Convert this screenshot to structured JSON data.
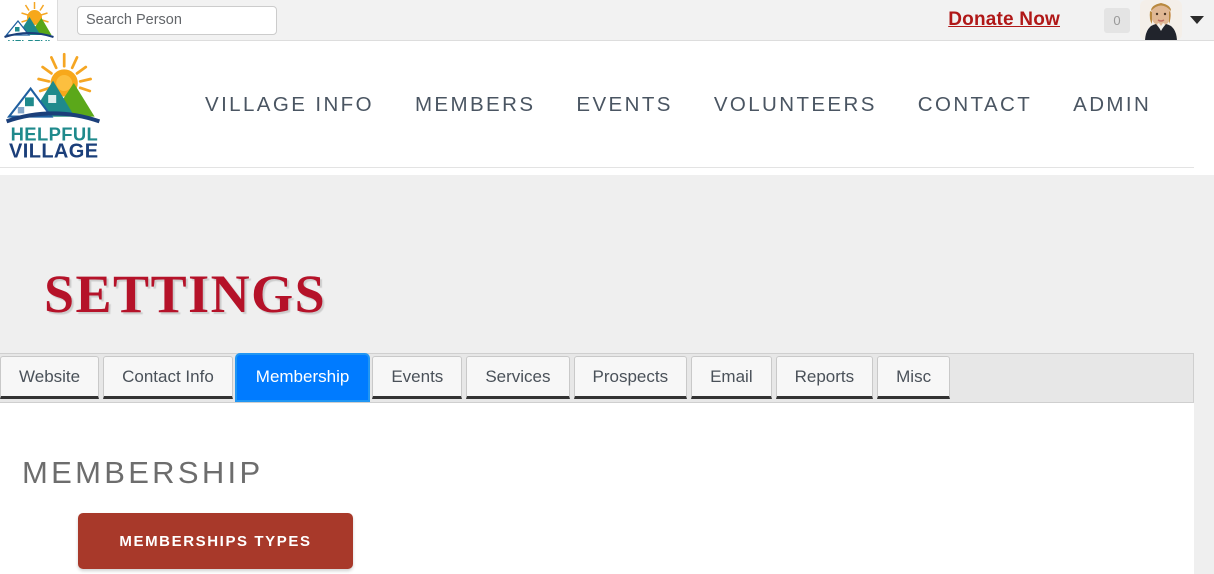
{
  "topbar": {
    "logo_icon": "helpful-village-mini-logo",
    "search": {
      "placeholder": "Search Person",
      "value": ""
    },
    "donate_label": "Donate Now",
    "cart_count": "0",
    "avatar_icon": "user-avatar-photo",
    "dropdown_icon": "chevron-down-icon"
  },
  "header": {
    "logo_icon": "helpful-village-logo",
    "logo_text_top": "HELPFUL",
    "logo_text_bottom": "VILLAGE",
    "nav": [
      {
        "label": "VILLAGE INFO"
      },
      {
        "label": "MEMBERS"
      },
      {
        "label": "EVENTS"
      },
      {
        "label": "VOLUNTEERS"
      },
      {
        "label": "CONTACT"
      },
      {
        "label": "ADMIN"
      }
    ]
  },
  "banner": {
    "title": "SETTINGS"
  },
  "tabs": [
    {
      "label": "Website",
      "active": false
    },
    {
      "label": "Contact Info",
      "active": false
    },
    {
      "label": "Membership",
      "active": true
    },
    {
      "label": "Events",
      "active": false
    },
    {
      "label": "Services",
      "active": false
    },
    {
      "label": "Prospects",
      "active": false
    },
    {
      "label": "Email",
      "active": false
    },
    {
      "label": "Reports",
      "active": false
    },
    {
      "label": "Misc",
      "active": false
    }
  ],
  "content": {
    "section_title": "MEMBERSHIP",
    "memberships_types_button": "MEMBERSHIPS TYPES"
  },
  "colors": {
    "accent_blue": "#007bff",
    "donate_red": "#b01818",
    "title_red": "#b51229",
    "button_brick": "#a8392a",
    "banner_grey": "#efefef",
    "tabstrip_grey": "#e7e7e7"
  }
}
